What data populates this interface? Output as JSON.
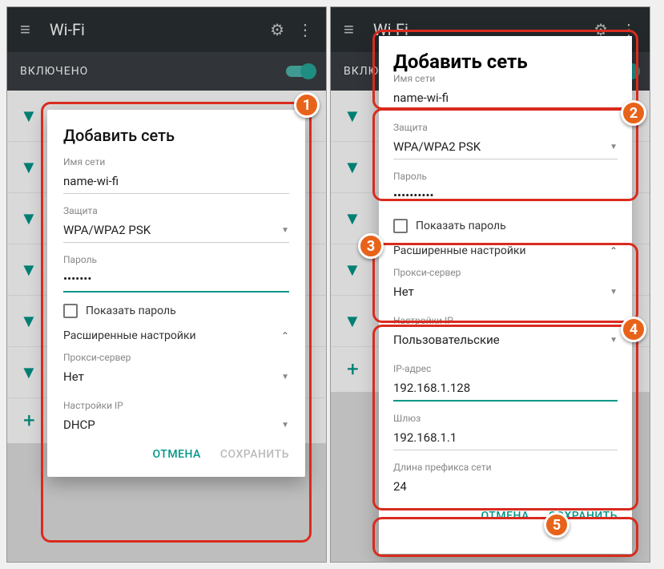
{
  "appbar": {
    "title": "Wi-Fi"
  },
  "toggle": {
    "label": "ВКЛЮЧЕНО"
  },
  "dialog1": {
    "title": "Добавить сеть",
    "network_label": "Имя сети",
    "network_value": "name-wi-fi",
    "security_label": "Защита",
    "security_value": "WPA/WPA2 PSK",
    "password_label": "Пароль",
    "password_value": "•••••••",
    "show_password": "Показать пароль",
    "advanced": "Расширенные настройки",
    "proxy_label": "Прокси-сервер",
    "proxy_value": "Нет",
    "ip_label": "Настройки IP",
    "ip_value": "DHCP",
    "cancel": "ОТМЕНА",
    "save": "СОХРАНИТЬ"
  },
  "dialog2": {
    "title": "Добавить сеть",
    "network_label": "Имя сети",
    "network_value": "name-wi-fi",
    "security_label": "Защита",
    "security_value": "WPA/WPA2 PSK",
    "password_label": "Пароль",
    "password_value": "••••••••••",
    "show_password": "Показать пароль",
    "advanced": "Расширенные настройки",
    "proxy_label": "Прокси-сервер",
    "proxy_value": "Нет",
    "ip_label": "Настройки IP",
    "ip_value": "Пользовательские",
    "ipaddr_label": "IP-адрес",
    "ipaddr_value": "192.168.1.128",
    "gateway_label": "Шлюз",
    "gateway_value": "192.168.1.1",
    "prefix_label": "Длина префикса сети",
    "prefix_value": "24",
    "cancel": "ОТМЕНА",
    "save": "СОХРАНИТЬ"
  },
  "steps": [
    "1",
    "2",
    "3",
    "4",
    "5"
  ]
}
